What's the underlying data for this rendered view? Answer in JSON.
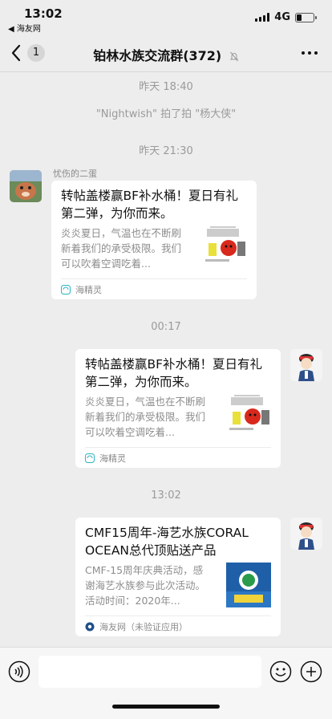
{
  "status_bar": {
    "time": "13:02",
    "back_app": "◀ 海友网",
    "network": "4G",
    "battery_level": 0.3
  },
  "nav": {
    "back_count": "1",
    "title": "铂林水族交流群(372)"
  },
  "messages": {
    "t1": "昨天 18:40",
    "sys1": "\"Nightwish\" 拍了拍 \"杨大侠\"",
    "t2": "昨天 21:30",
    "card1": {
      "sender": "忧伤的二蛋",
      "title": "转帖盖楼赢BF补水桶！夏日有礼第二弹，为你而来。",
      "desc": "炎炎夏日，气温也在不断刷新着我们的承受极限。我们可以吹着空调吃着...",
      "source": "海精灵"
    },
    "t3": "00:17",
    "card2": {
      "title": "转帖盖楼赢BF补水桶！夏日有礼第二弹，为你而来。",
      "desc": "炎炎夏日，气温也在不断刷新着我们的承受极限。我们可以吹着空调吃着...",
      "source": "海精灵"
    },
    "t4": "13:02",
    "card3": {
      "title": "CMF15周年-海艺水族CORAL OCEAN总代顶贴送产品",
      "desc": "CMF-15周年庆典活动，感谢海艺水族参与此次活动。活动时间：2020年...",
      "source": "海友网（未验证应用）"
    }
  },
  "colors": {
    "background": "#ededed",
    "card": "#ffffff",
    "muted_text": "#9a9a9a"
  }
}
